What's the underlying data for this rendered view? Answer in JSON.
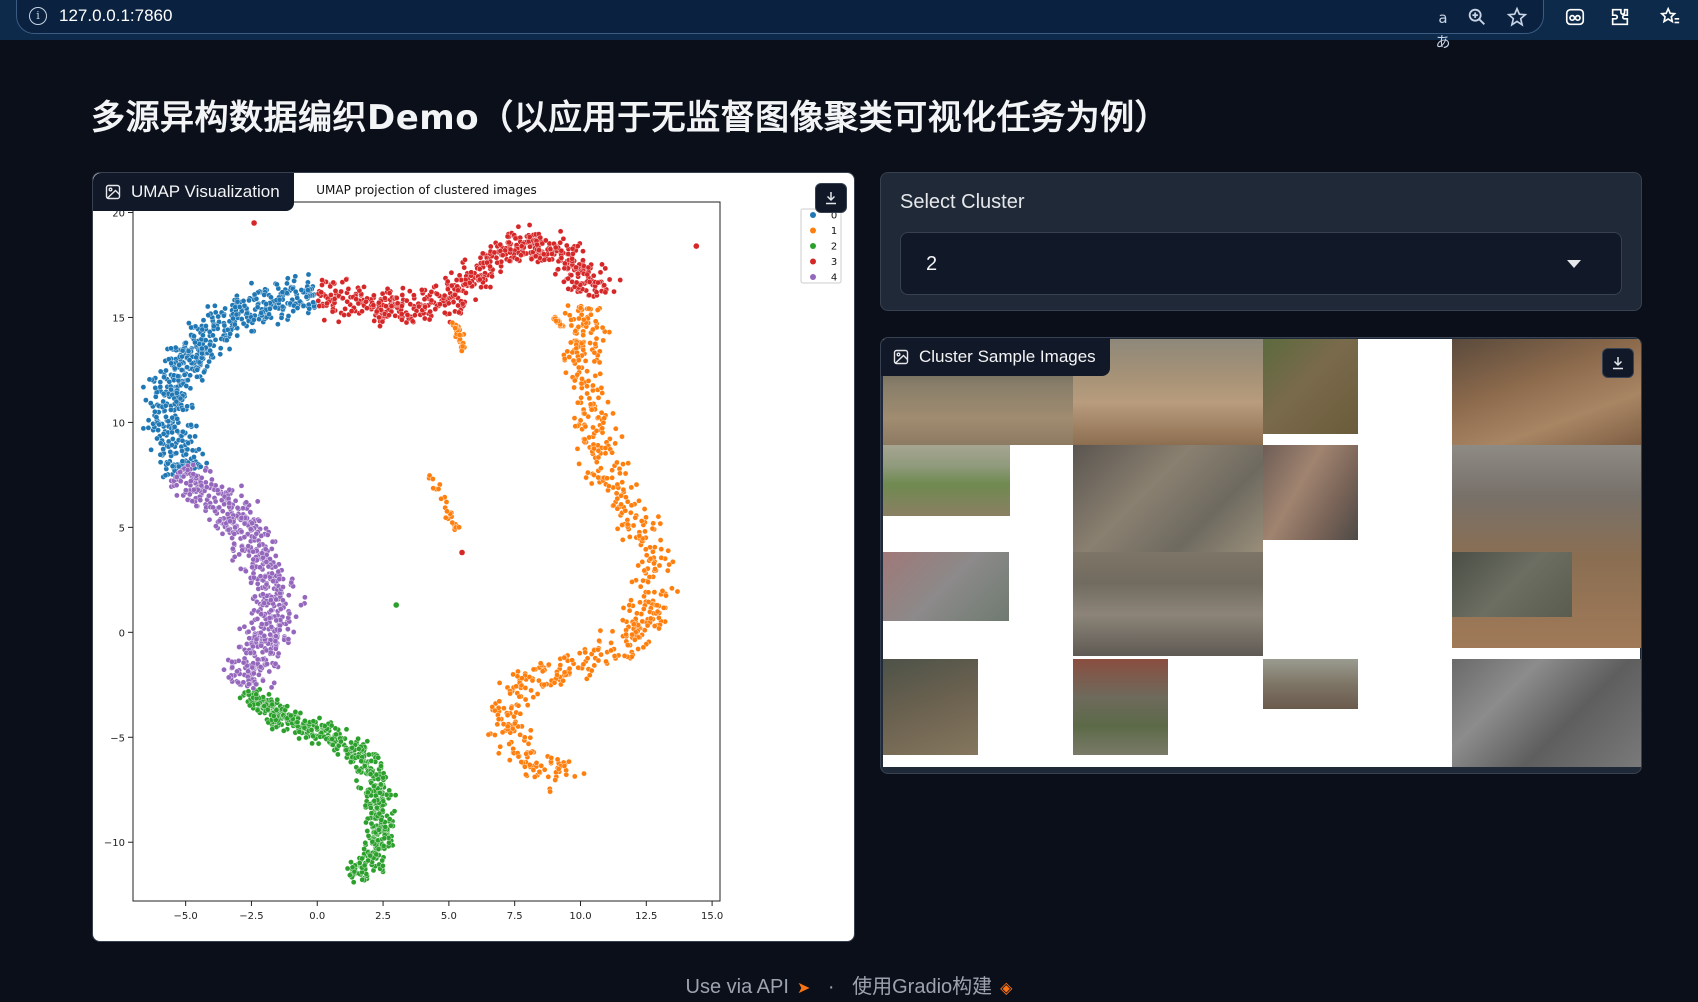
{
  "browser": {
    "url": "127.0.0.1:7860"
  },
  "page": {
    "title": "多源异构数据编织Demo（以应用于无监督图像聚类可视化任务为例）"
  },
  "umap_panel": {
    "label": "UMAP Visualization",
    "icon": "image-icon"
  },
  "select_panel": {
    "label": "Select Cluster",
    "selected_value": "2"
  },
  "gallery_panel": {
    "label": "Cluster Sample Images",
    "icon": "image-icon"
  },
  "footer": {
    "api_text": "Use via API",
    "separator": "·",
    "built_with": "使用Gradio构建"
  },
  "chart_data": {
    "type": "scatter",
    "title": "UMAP projection of clustered images",
    "xlabel": "",
    "ylabel": "",
    "xlim": [
      -7.0,
      15.3
    ],
    "ylim": [
      -12.8,
      20.5
    ],
    "xticks": [
      -5.0,
      -2.5,
      0.0,
      2.5,
      5.0,
      7.5,
      10.0,
      12.5,
      15.0
    ],
    "yticks": [
      20,
      15,
      10,
      5,
      0,
      -5,
      -10
    ],
    "xtick_labels": [
      "−5.0",
      "−2.5",
      "0.0",
      "2.5",
      "5.0",
      "7.5",
      "10.0",
      "12.5",
      "15.0"
    ],
    "ytick_labels": [
      "20",
      "15",
      "10",
      "5",
      "0",
      "−5",
      "−10"
    ],
    "legend_position": "top-right",
    "grid": false,
    "series": [
      {
        "name": "0",
        "color": "#1f77b4",
        "path": [
          [
            -0.1,
            16.0
          ],
          [
            -1.5,
            15.8
          ],
          [
            -3.0,
            15.1
          ],
          [
            -4.3,
            13.9
          ],
          [
            -5.3,
            12.4
          ],
          [
            -5.7,
            10.6
          ],
          [
            -5.4,
            8.8
          ],
          [
            -4.8,
            7.6
          ]
        ],
        "width": 1.3
      },
      {
        "name": "1",
        "color": "#ff7f0e",
        "path": [
          [
            10.2,
            15.6
          ],
          [
            10.0,
            13.5
          ],
          [
            10.2,
            11.3
          ],
          [
            10.6,
            9.1
          ],
          [
            11.3,
            7.0
          ],
          [
            12.2,
            5.3
          ],
          [
            12.8,
            3.6
          ],
          [
            12.8,
            1.6
          ],
          [
            12.3,
            0.0
          ],
          [
            11.2,
            -0.8
          ],
          [
            9.7,
            -1.6
          ],
          [
            8.3,
            -2.2
          ],
          [
            7.2,
            -3.2
          ],
          [
            7.1,
            -4.5
          ],
          [
            7.9,
            -5.8
          ],
          [
            8.6,
            -6.6
          ],
          [
            9.3,
            -6.8
          ],
          [
            9.8,
            -6.3
          ]
        ],
        "width": 1.15
      },
      {
        "name": "2",
        "color": "#2ca02c",
        "path": [
          [
            -2.7,
            -2.8
          ],
          [
            -2.0,
            -3.5
          ],
          [
            -0.8,
            -4.4
          ],
          [
            0.7,
            -5.0
          ],
          [
            1.7,
            -5.8
          ],
          [
            2.2,
            -7.2
          ],
          [
            2.4,
            -8.8
          ],
          [
            2.3,
            -10.4
          ],
          [
            1.8,
            -11.3
          ],
          [
            1.2,
            -11.5
          ]
        ],
        "width": 0.8
      },
      {
        "name": "3",
        "color": "#d62728",
        "path": [
          [
            0.0,
            16.1
          ],
          [
            1.2,
            15.8
          ],
          [
            2.8,
            15.4
          ],
          [
            4.3,
            15.6
          ],
          [
            5.4,
            16.2
          ],
          [
            6.2,
            17.4
          ],
          [
            7.2,
            18.4
          ],
          [
            8.5,
            18.5
          ],
          [
            9.6,
            17.8
          ],
          [
            10.4,
            16.8
          ],
          [
            10.5,
            16.0
          ]
        ],
        "width": 1.2
      },
      {
        "name": "4",
        "color": "#9467bd",
        "path": [
          [
            -5.3,
            7.6
          ],
          [
            -4.2,
            6.8
          ],
          [
            -3.1,
            5.5
          ],
          [
            -2.3,
            3.9
          ],
          [
            -1.6,
            1.9
          ],
          [
            -1.8,
            0.0
          ],
          [
            -2.3,
            -1.6
          ],
          [
            -2.8,
            -2.6
          ]
        ],
        "width": 1.3
      }
    ],
    "outliers": [
      {
        "series": "3",
        "x": -2.4,
        "y": 19.5
      },
      {
        "series": "3",
        "x": 14.4,
        "y": 18.4
      },
      {
        "series": "3",
        "x": 5.5,
        "y": 3.8
      },
      {
        "series": "2",
        "x": 3.0,
        "y": 1.3
      }
    ],
    "small_clusters": [
      {
        "series": "1",
        "path": [
          [
            4.3,
            7.6
          ],
          [
            4.8,
            6.3
          ],
          [
            5.3,
            4.9
          ],
          [
            4.9,
            5.5
          ]
        ],
        "width": 0.25
      },
      {
        "series": "1",
        "path": [
          [
            5.2,
            14.9
          ],
          [
            5.4,
            14.2
          ],
          [
            5.6,
            13.4
          ]
        ],
        "width": 0.2
      },
      {
        "series": "1",
        "path": [
          [
            9.0,
            15.0
          ],
          [
            9.3,
            14.6
          ]
        ],
        "width": 0.15
      }
    ]
  }
}
